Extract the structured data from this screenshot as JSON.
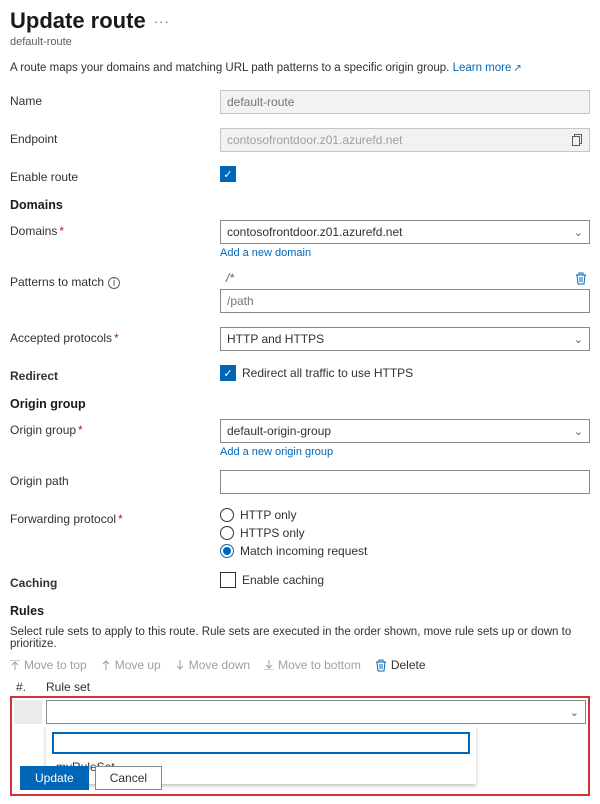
{
  "header": {
    "title": "Update route",
    "subtitle": "default-route"
  },
  "intro": {
    "text": "A route maps your domains and matching URL path patterns to a specific origin group. ",
    "learn_more": "Learn more"
  },
  "labels": {
    "name": "Name",
    "endpoint": "Endpoint",
    "enable_route": "Enable route",
    "domains_section": "Domains",
    "domains": "Domains",
    "add_domain": "Add a new domain",
    "patterns": "Patterns to match",
    "accepted_protocols": "Accepted protocols",
    "redirect_section": "Redirect",
    "redirect_desc": "Redirect all traffic to use HTTPS",
    "origin_group_section": "Origin group",
    "origin_group": "Origin group",
    "add_origin": "Add a new origin group",
    "origin_path": "Origin path",
    "forwarding_protocol": "Forwarding protocol",
    "caching_section": "Caching",
    "enable_caching": "Enable caching",
    "rules_section": "Rules",
    "rules_desc": "Select rule sets to apply to this route. Rule sets are executed in the order shown, move rule sets up or down to prioritize."
  },
  "fields": {
    "name_placeholder": "default-route",
    "endpoint_value": "contosofrontdoor.z01.azurefd.net",
    "domains_value": "contosofrontdoor.z01.azurefd.net",
    "pattern_locked": "/*",
    "pattern_placeholder": "/path",
    "accepted_protocols_value": "HTTP and HTTPS",
    "origin_group_value": "default-origin-group",
    "origin_path_value": ""
  },
  "forwarding_options": {
    "http": "HTTP only",
    "https": "HTTPS only",
    "match": "Match incoming request"
  },
  "toolbar": {
    "move_top": "Move to top",
    "move_up": "Move up",
    "move_down": "Move down",
    "move_bottom": "Move to bottom",
    "delete": "Delete"
  },
  "table": {
    "col_num": "#.",
    "col_name": "Rule set"
  },
  "dropdown": {
    "option": "myRuleSet"
  },
  "footer": {
    "update": "Update",
    "cancel": "Cancel"
  }
}
